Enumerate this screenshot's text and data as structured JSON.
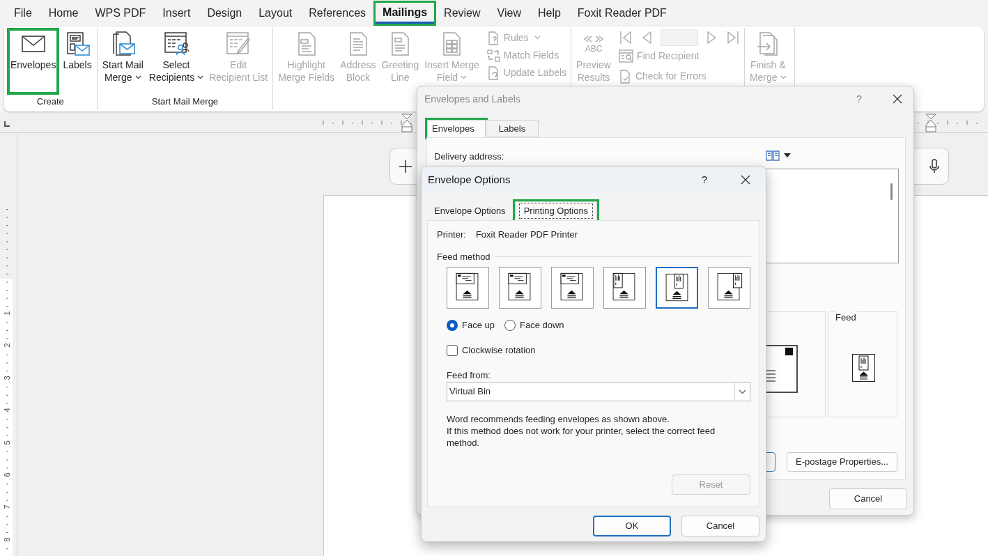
{
  "menu_tabs": [
    {
      "label": "File",
      "selected": false,
      "highlighted": false
    },
    {
      "label": "Home",
      "selected": false,
      "highlighted": false
    },
    {
      "label": "WPS PDF",
      "selected": false,
      "highlighted": false
    },
    {
      "label": "Insert",
      "selected": false,
      "highlighted": false
    },
    {
      "label": "Design",
      "selected": false,
      "highlighted": false
    },
    {
      "label": "Layout",
      "selected": false,
      "highlighted": false
    },
    {
      "label": "References",
      "selected": false,
      "highlighted": false
    },
    {
      "label": "Mailings",
      "selected": true,
      "highlighted": true
    },
    {
      "label": "Review",
      "selected": false,
      "highlighted": false
    },
    {
      "label": "View",
      "selected": false,
      "highlighted": false
    },
    {
      "label": "Help",
      "selected": false,
      "highlighted": false
    },
    {
      "label": "Foxit Reader PDF",
      "selected": false,
      "highlighted": false
    }
  ],
  "ribbon_groups": [
    {
      "label": "Create",
      "items": [
        {
          "kind": "large",
          "lines": [
            "Envelopes"
          ],
          "dropdown": false,
          "disabled": false,
          "highlighted": true
        },
        {
          "kind": "large",
          "lines": [
            "Labels"
          ],
          "dropdown": false,
          "disabled": false,
          "highlighted": false
        }
      ]
    },
    {
      "label": "Start Mail Merge",
      "items": [
        {
          "kind": "large",
          "lines": [
            "Start Mail",
            "Merge"
          ],
          "dropdown": true,
          "disabled": false,
          "highlighted": false
        },
        {
          "kind": "large",
          "lines": [
            "Select",
            "Recipients"
          ],
          "dropdown": true,
          "disabled": false,
          "highlighted": false
        },
        {
          "kind": "large",
          "lines": [
            "Edit",
            "Recipient List"
          ],
          "dropdown": false,
          "disabled": true,
          "highlighted": false
        }
      ]
    },
    {
      "items": [
        {
          "kind": "large",
          "lines": [
            "Highlight",
            "Merge Fields"
          ],
          "dropdown": false,
          "disabled": true,
          "highlighted": false
        },
        {
          "kind": "large",
          "lines": [
            "Address",
            "Block"
          ],
          "dropdown": false,
          "disabled": true,
          "highlighted": false
        },
        {
          "kind": "large",
          "lines": [
            "Greeting",
            "Line"
          ],
          "dropdown": false,
          "disabled": true,
          "highlighted": false
        },
        {
          "kind": "large",
          "lines": [
            "Insert Merge",
            "Field"
          ],
          "dropdown": true,
          "disabled": true,
          "highlighted": false
        },
        {
          "kind": "small_stack",
          "items": [
            {
              "label": "Rules",
              "dropdown": true,
              "disabled": true
            },
            {
              "label": "Match Fields",
              "dropdown": false,
              "disabled": true
            },
            {
              "label": "Update Labels",
              "dropdown": false,
              "disabled": true
            }
          ]
        }
      ]
    },
    {
      "items": [
        {
          "kind": "large",
          "icon_caption": "ABC",
          "lines": [
            "Preview",
            "Results"
          ],
          "dropdown": false,
          "disabled": true,
          "highlighted": false
        },
        {
          "kind": "nav_stack",
          "items": [
            {
              "label": "Find Recipient",
              "dropdown": false,
              "disabled": true
            },
            {
              "label": "Check for Errors",
              "dropdown": false,
              "disabled": true
            }
          ]
        }
      ]
    },
    {
      "items": [
        {
          "kind": "large",
          "lines": [
            "Finish &",
            "Merge"
          ],
          "dropdown": true,
          "disabled": true,
          "highlighted": false
        }
      ]
    }
  ],
  "ruler_numbers": [
    "1",
    "2",
    "3",
    "4",
    "5",
    "6",
    "7",
    "8"
  ],
  "envelopes_and_labels": {
    "title": "Envelopes and Labels",
    "help_glyph": "?",
    "tabs": [
      {
        "label": "Envelopes",
        "selected": true,
        "highlighted": true
      },
      {
        "label": "Labels",
        "selected": false,
        "highlighted": false
      }
    ],
    "delivery_address_label": "Delivery address:",
    "feed_label": "Feed",
    "buttons": [
      "E-postage Properties...",
      "Cancel"
    ]
  },
  "envelope_options": {
    "title": "Envelope Options",
    "help_glyph": "?",
    "tabs": [
      {
        "label": "Envelope Options",
        "selected": false,
        "highlighted": false
      },
      {
        "label": "Printing Options",
        "selected": true,
        "highlighted": true
      }
    ],
    "printer_label": "Printer:",
    "printer_name": "Foxit Reader PDF Printer",
    "feed_method_label": "Feed method",
    "feed_methods": [
      {
        "selected": false
      },
      {
        "selected": false
      },
      {
        "selected": false
      },
      {
        "selected": false
      },
      {
        "selected": true
      },
      {
        "selected": false
      }
    ],
    "face": [
      {
        "label": "Face up",
        "selected": true
      },
      {
        "label": "Face down",
        "selected": false
      }
    ],
    "clockwise_rotation": {
      "label": "Clockwise rotation",
      "checked": false
    },
    "feed_from": {
      "label": "Feed from:",
      "value": "Virtual Bin"
    },
    "note_lines": [
      "Word recommends feeding envelopes as shown above.",
      "If this method does not work for your printer, select the correct feed method."
    ],
    "reset": {
      "label": "Reset",
      "disabled": true
    },
    "buttons": [
      {
        "label": "OK",
        "default": true
      },
      {
        "label": "Cancel",
        "default": false
      }
    ]
  }
}
